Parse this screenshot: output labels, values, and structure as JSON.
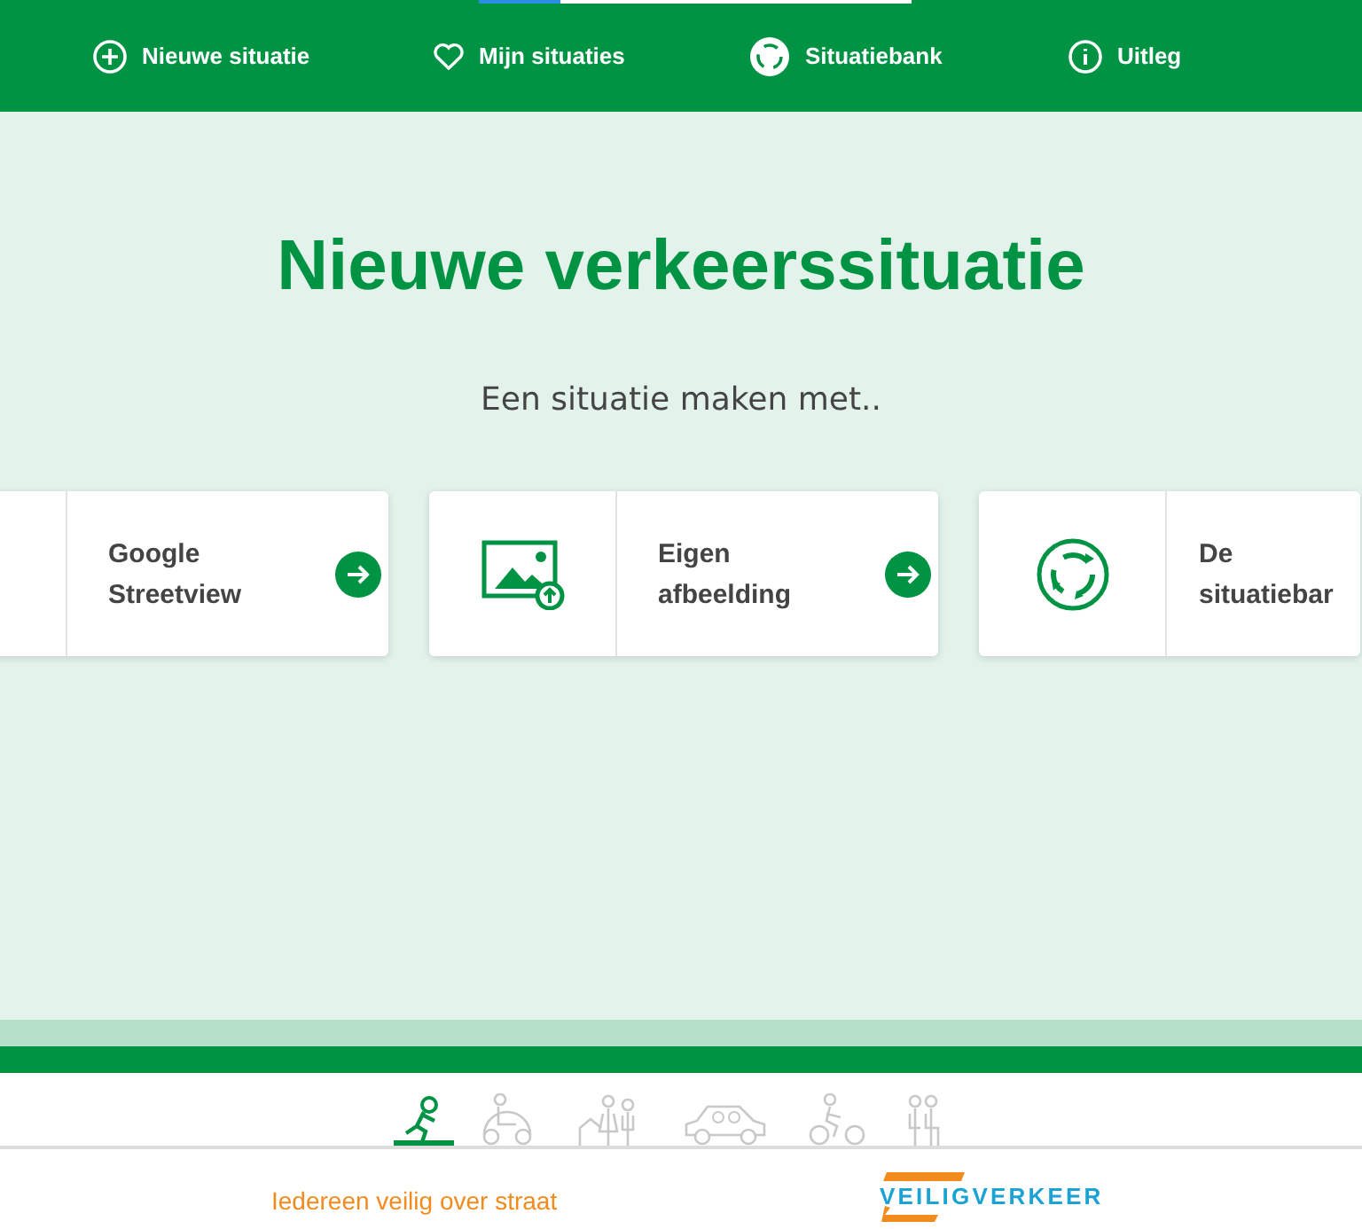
{
  "loading_bar": {
    "level": 0.19
  },
  "nav": [
    {
      "label": "Nieuwe situatie"
    },
    {
      "label": "Mijn situaties"
    },
    {
      "label": "Situatiebank"
    },
    {
      "label": "Uitleg"
    }
  ],
  "title": "Nieuwe verkeerssituatie",
  "subtitle": "Een situatie maken met..",
  "cards": [
    {
      "label": "Google Streetview",
      "arrow": true
    },
    {
      "label": "Eigen afbeelding",
      "arrow": true
    },
    {
      "label": "De situatiebar",
      "arrow": false
    }
  ],
  "footer": {
    "tagline": "Iedereen veilig over straat",
    "logo": "VEILIGVERKEER"
  }
}
